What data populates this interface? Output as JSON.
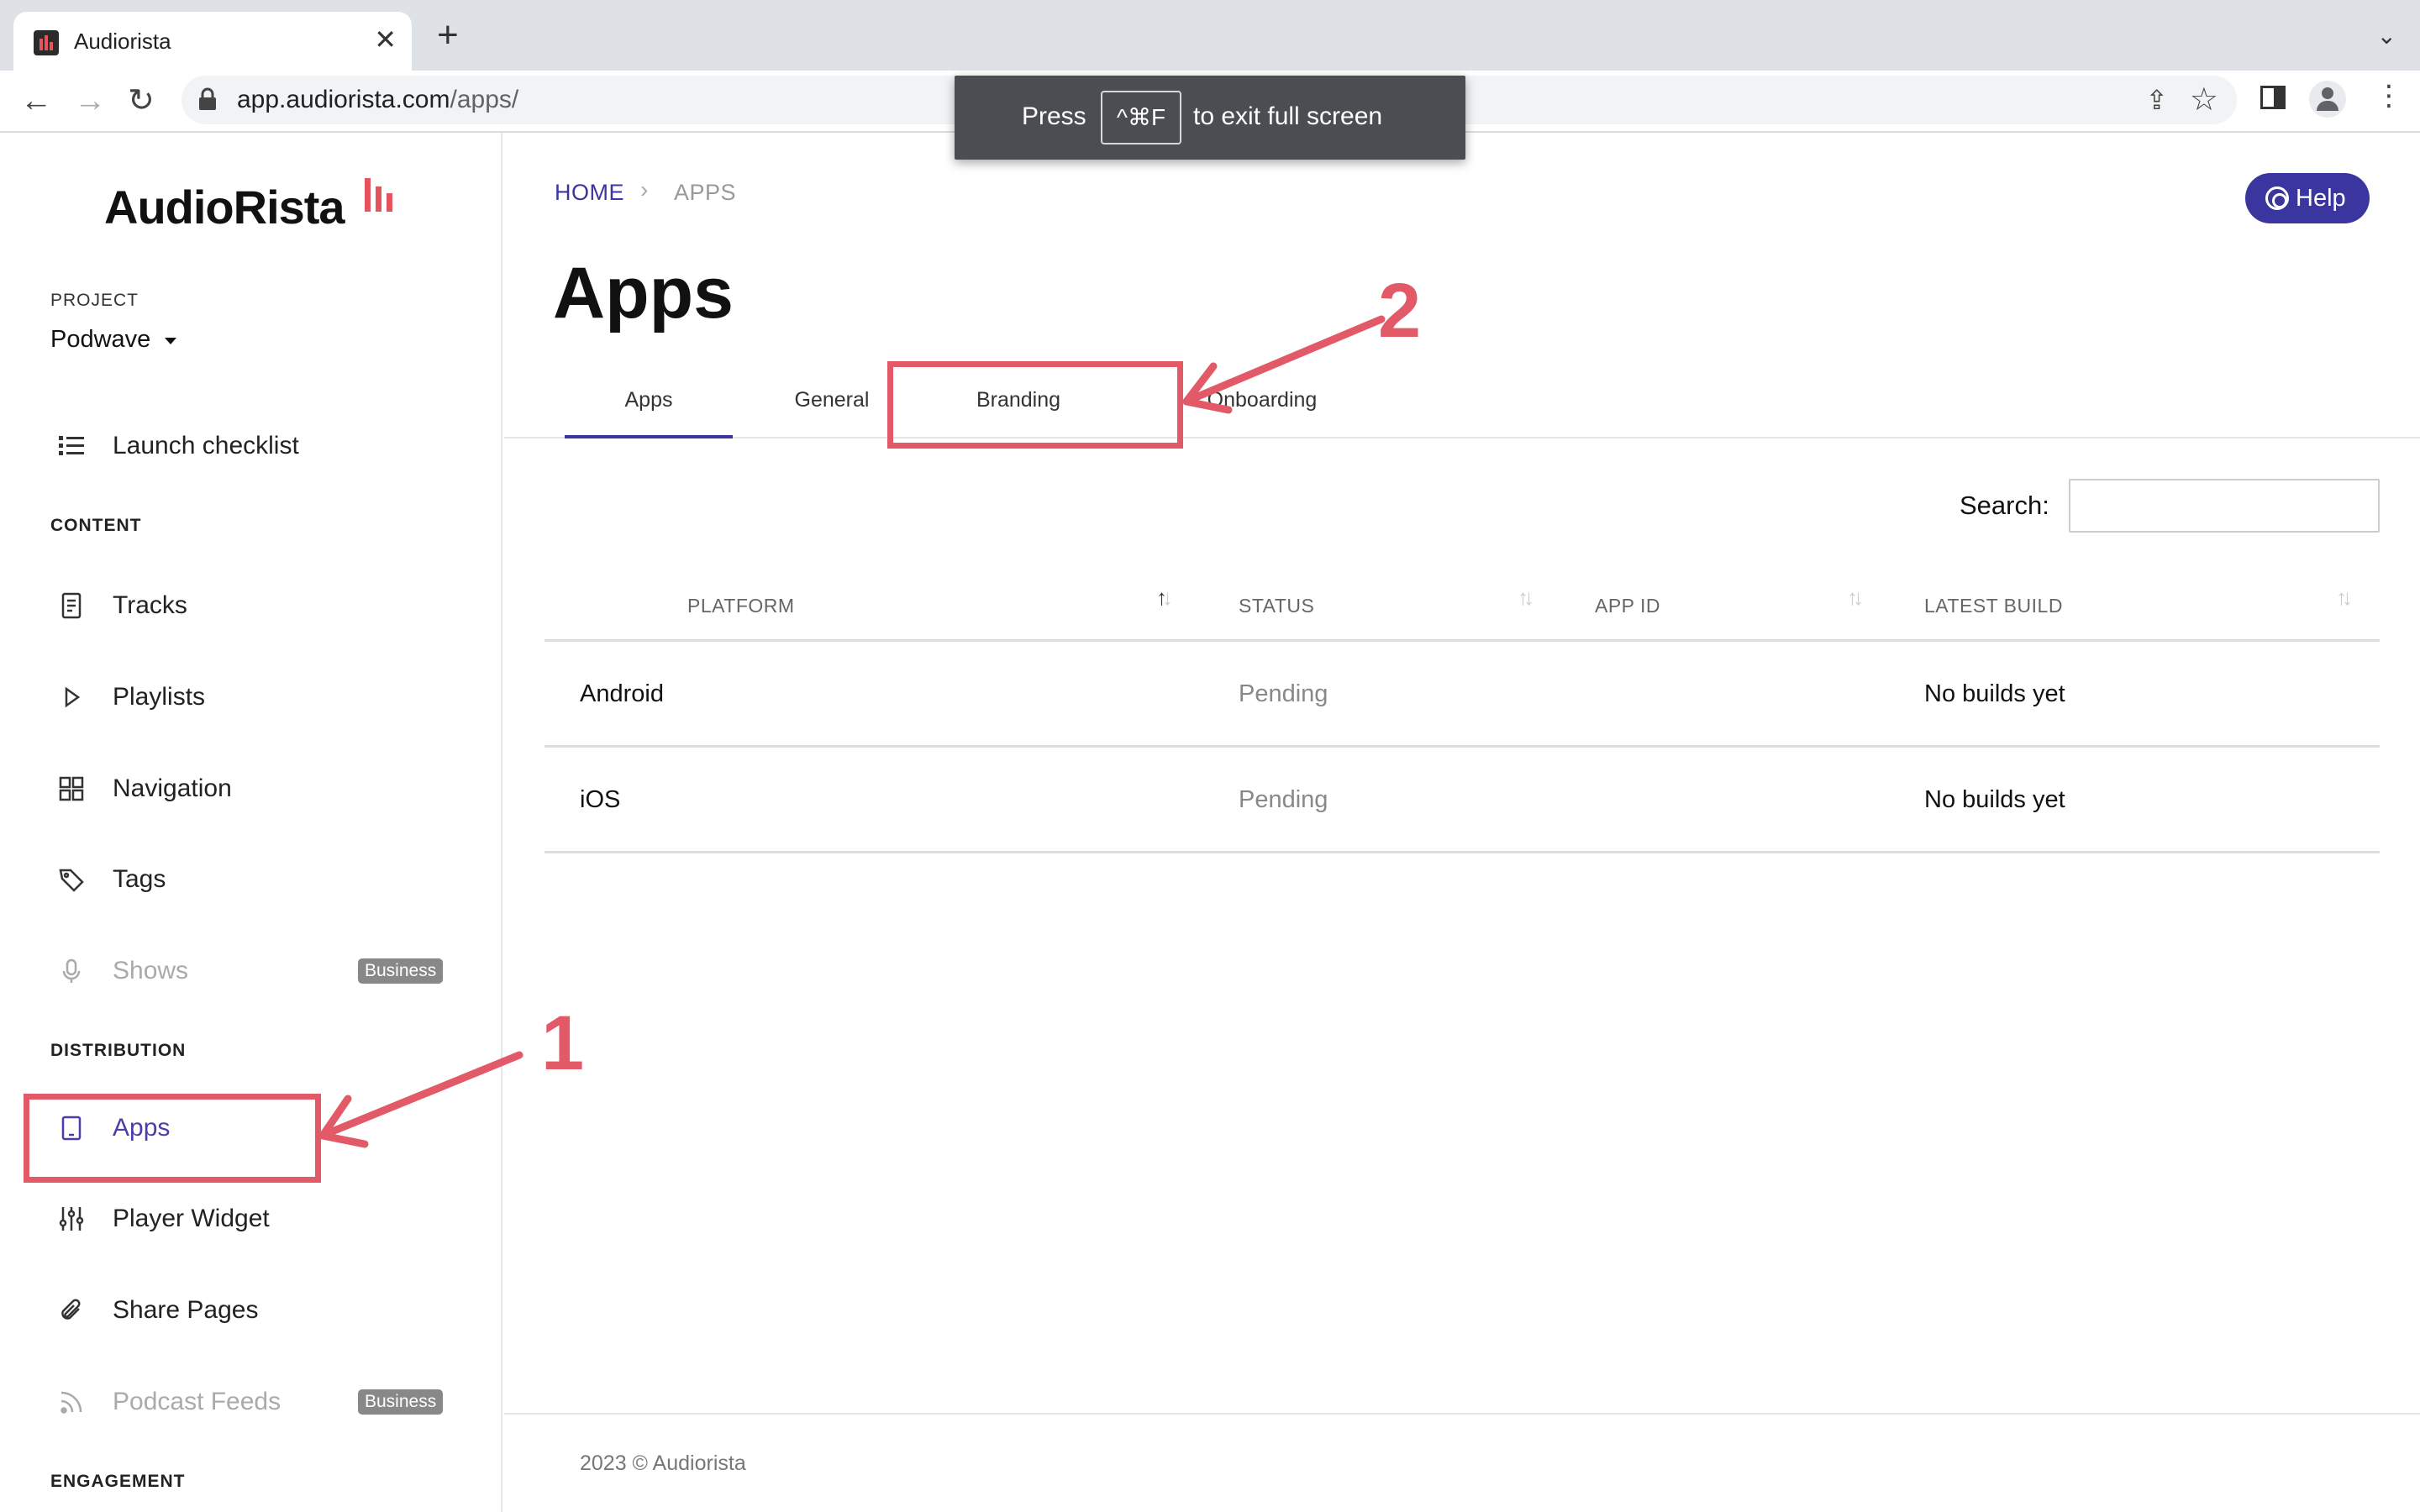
{
  "browser": {
    "tab_title": "Audiorista",
    "tab_close": "✕",
    "new_tab": "+",
    "tab_menu": "⌄",
    "url_host": "app.audiorista.com",
    "url_path": "/apps/",
    "back": "←",
    "forward": "→",
    "reload": "↻",
    "share_glyph": "⇪",
    "star_glyph": "☆",
    "menu_glyph": "⋮"
  },
  "fullscreen_toast": {
    "press": "Press",
    "key": "^⌘F",
    "exit": "to exit full screen"
  },
  "sidebar": {
    "logo": "AudioRista",
    "project_label": "PROJECT",
    "project_name": "Podwave",
    "launch_checklist": "Launch checklist",
    "content_label": "CONTENT",
    "tracks": "Tracks",
    "playlists": "Playlists",
    "navigation": "Navigation",
    "tags": "Tags",
    "shows": "Shows",
    "business_badge": "Business",
    "distribution_label": "DISTRIBUTION",
    "apps": "Apps",
    "player_widget": "Player Widget",
    "share_pages": "Share Pages",
    "podcast_feeds": "Podcast Feeds",
    "engagement_label": "ENGAGEMENT"
  },
  "main": {
    "crumb_home": "HOME",
    "crumb_sep": "›",
    "crumb_current": "APPS",
    "help": "Help",
    "title": "Apps",
    "tabs": [
      "Apps",
      "General",
      "Branding",
      "Onboarding"
    ],
    "active_tab": "Apps",
    "search_label": "Search:",
    "search_value": "",
    "columns": [
      "PLATFORM",
      "STATUS",
      "APP ID",
      "LATEST BUILD"
    ],
    "rows": [
      {
        "platform": "Android",
        "status": "Pending",
        "app_id": "",
        "latest_build": "No builds yet"
      },
      {
        "platform": "iOS",
        "status": "Pending",
        "app_id": "",
        "latest_build": "No builds yet"
      }
    ],
    "footer": "2023 © Audiorista"
  },
  "annotations": {
    "one": "1",
    "two": "2",
    "color": "#e25a67"
  },
  "colors": {
    "accent": "#3b35a0",
    "brand_red": "#e5545e"
  }
}
